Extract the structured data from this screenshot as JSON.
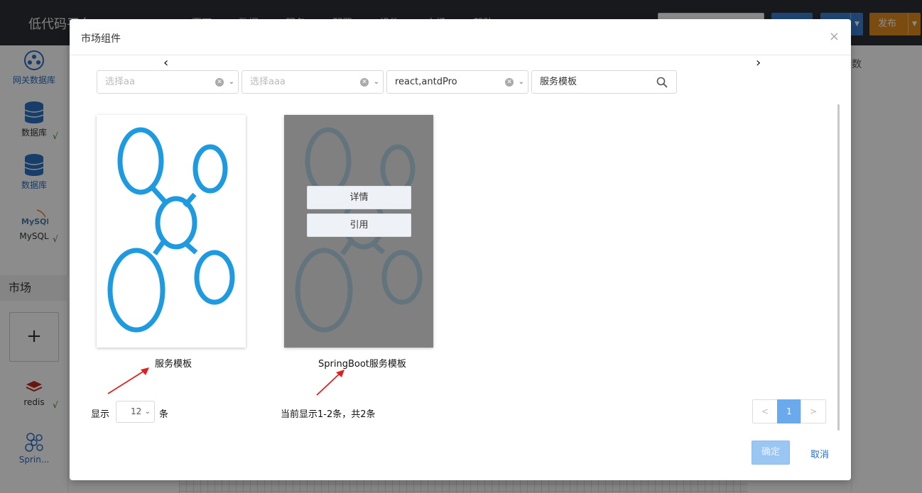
{
  "app": {
    "title": "低代码平台",
    "nav": [
      "页面",
      "数据",
      "服务",
      "配置",
      "组件",
      "市场",
      "帮助"
    ],
    "publish_label": "发布"
  },
  "sidebar": {
    "items": [
      {
        "label": "网关数据库",
        "icon": "gateway-db-icon"
      },
      {
        "label": "数据库",
        "icon": "database-icon",
        "check": "√"
      },
      {
        "label": "数据库",
        "icon": "database-icon"
      },
      {
        "label": "MySQL",
        "icon": "mysql-icon",
        "check": "√"
      }
    ],
    "market_title": "市场",
    "add_label": "+",
    "market_items": [
      {
        "label": "redis",
        "icon": "redis-icon",
        "check": "√"
      },
      {
        "label": "Sprin...",
        "icon": "spring-icon"
      }
    ]
  },
  "right_panel": {
    "title": "属性参数"
  },
  "modal": {
    "title": "市场组件",
    "close": "×",
    "prev_arrow": "‹",
    "next_arrow": "›",
    "filters": [
      {
        "placeholder": "选择aa",
        "value": ""
      },
      {
        "placeholder": "选择aaa",
        "value": ""
      },
      {
        "placeholder": "",
        "value": "react,antdPro"
      }
    ],
    "search": {
      "value": "服务模板"
    },
    "cards": [
      {
        "name": "服务模板",
        "icon": "network-icon"
      },
      {
        "name": "SpringBoot服务模板",
        "icon": "network-icon",
        "hover": true,
        "actions": [
          "详情",
          "引用"
        ]
      }
    ],
    "pagination": {
      "show_label": "显示",
      "page_size": "12",
      "unit_label": "条",
      "info": "当前显示1-2条，共2条",
      "prev": "<",
      "current": "1",
      "next": ">"
    },
    "ok_label": "确定",
    "cancel_label": "取消"
  },
  "colors": {
    "topbar": "#2b2f33",
    "primary": "#3a7fd0",
    "publish": "#e08a1c",
    "network_blue": "#1e9ae0",
    "annotation_arrow": "#e02020"
  }
}
